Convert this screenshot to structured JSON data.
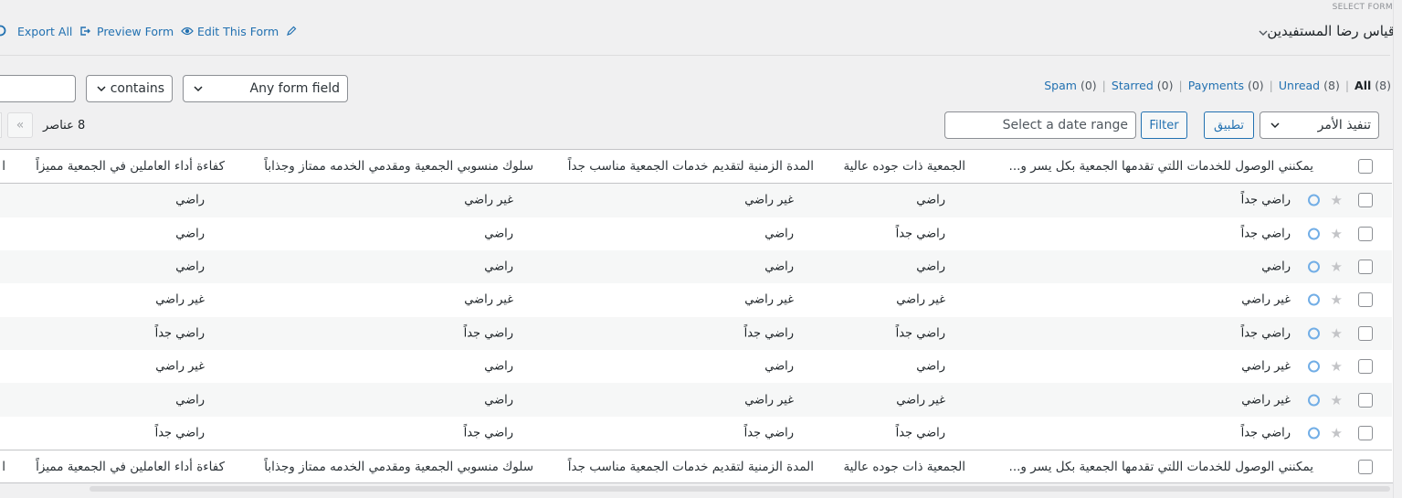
{
  "header": {
    "select_form_label": "SELECT FORM",
    "form_name": "قياس رضا المستفيدين",
    "links": [
      {
        "label": "Export All",
        "icon": "export-icon"
      },
      {
        "label": "Preview Form",
        "icon": "eye-icon"
      },
      {
        "label": "Edit This Form",
        "icon": "pencil-icon"
      }
    ]
  },
  "search": {
    "value": "",
    "operator": "contains",
    "field": "Any form field"
  },
  "views": {
    "all": {
      "label": "All",
      "count": "(8)"
    },
    "unread": {
      "label": "Unread",
      "count": "(8)"
    },
    "payments": {
      "label": "Payments",
      "count": "(0)"
    },
    "starred": {
      "label": "Starred",
      "count": "(0)"
    },
    "spam": {
      "label": "Spam",
      "count": "(0)"
    }
  },
  "actions": {
    "bulk_select": "تنفيذ الأمر",
    "apply": "تطبيق",
    "filter": "Filter",
    "date_placeholder": "Select a date range",
    "items_count": "8 عناصر",
    "first_page": "«"
  },
  "columns": [
    "يمكنني الوصول للخدمات اللتي تقدمها الجمعية بكل يسر و...",
    "الجمعية ذات جوده عالية",
    "المدة الزمنية لتقديم خدمات الجمعية مناسب جداً",
    "سلوك منسوبي الجمعية ومقدمي الخدمه ممتاز وجذاباً",
    "كفاءة أداء العاملين في الجمعية مميزاً",
    "ا"
  ],
  "rows": [
    [
      "راضي جداً",
      "راضي",
      "غير راضي",
      "غير راضي",
      "راضي"
    ],
    [
      "راضي جداً",
      "راضي جداً",
      "راضي",
      "راضي",
      "راضي"
    ],
    [
      "راضي",
      "راضي",
      "راضي",
      "راضي",
      "راضي"
    ],
    [
      "غير راضي",
      "غير راضي",
      "غير راضي",
      "غير راضي",
      "غير راضي"
    ],
    [
      "راضي جداً",
      "راضي جداً",
      "راضي جداً",
      "راضي جداً",
      "راضي جداً"
    ],
    [
      "غير راضي",
      "راضي",
      "راضي",
      "راضي",
      "غير راضي"
    ],
    [
      "غير راضي",
      "غير راضي",
      "غير راضي",
      "راضي",
      "راضي"
    ],
    [
      "راضي جداً",
      "راضي جداً",
      "راضي جداً",
      "راضي جداً",
      "راضي جداً"
    ]
  ],
  "colors": {
    "link": "#2271b1",
    "read_indicator": "#72aee6",
    "star": "#c3c4c7"
  }
}
